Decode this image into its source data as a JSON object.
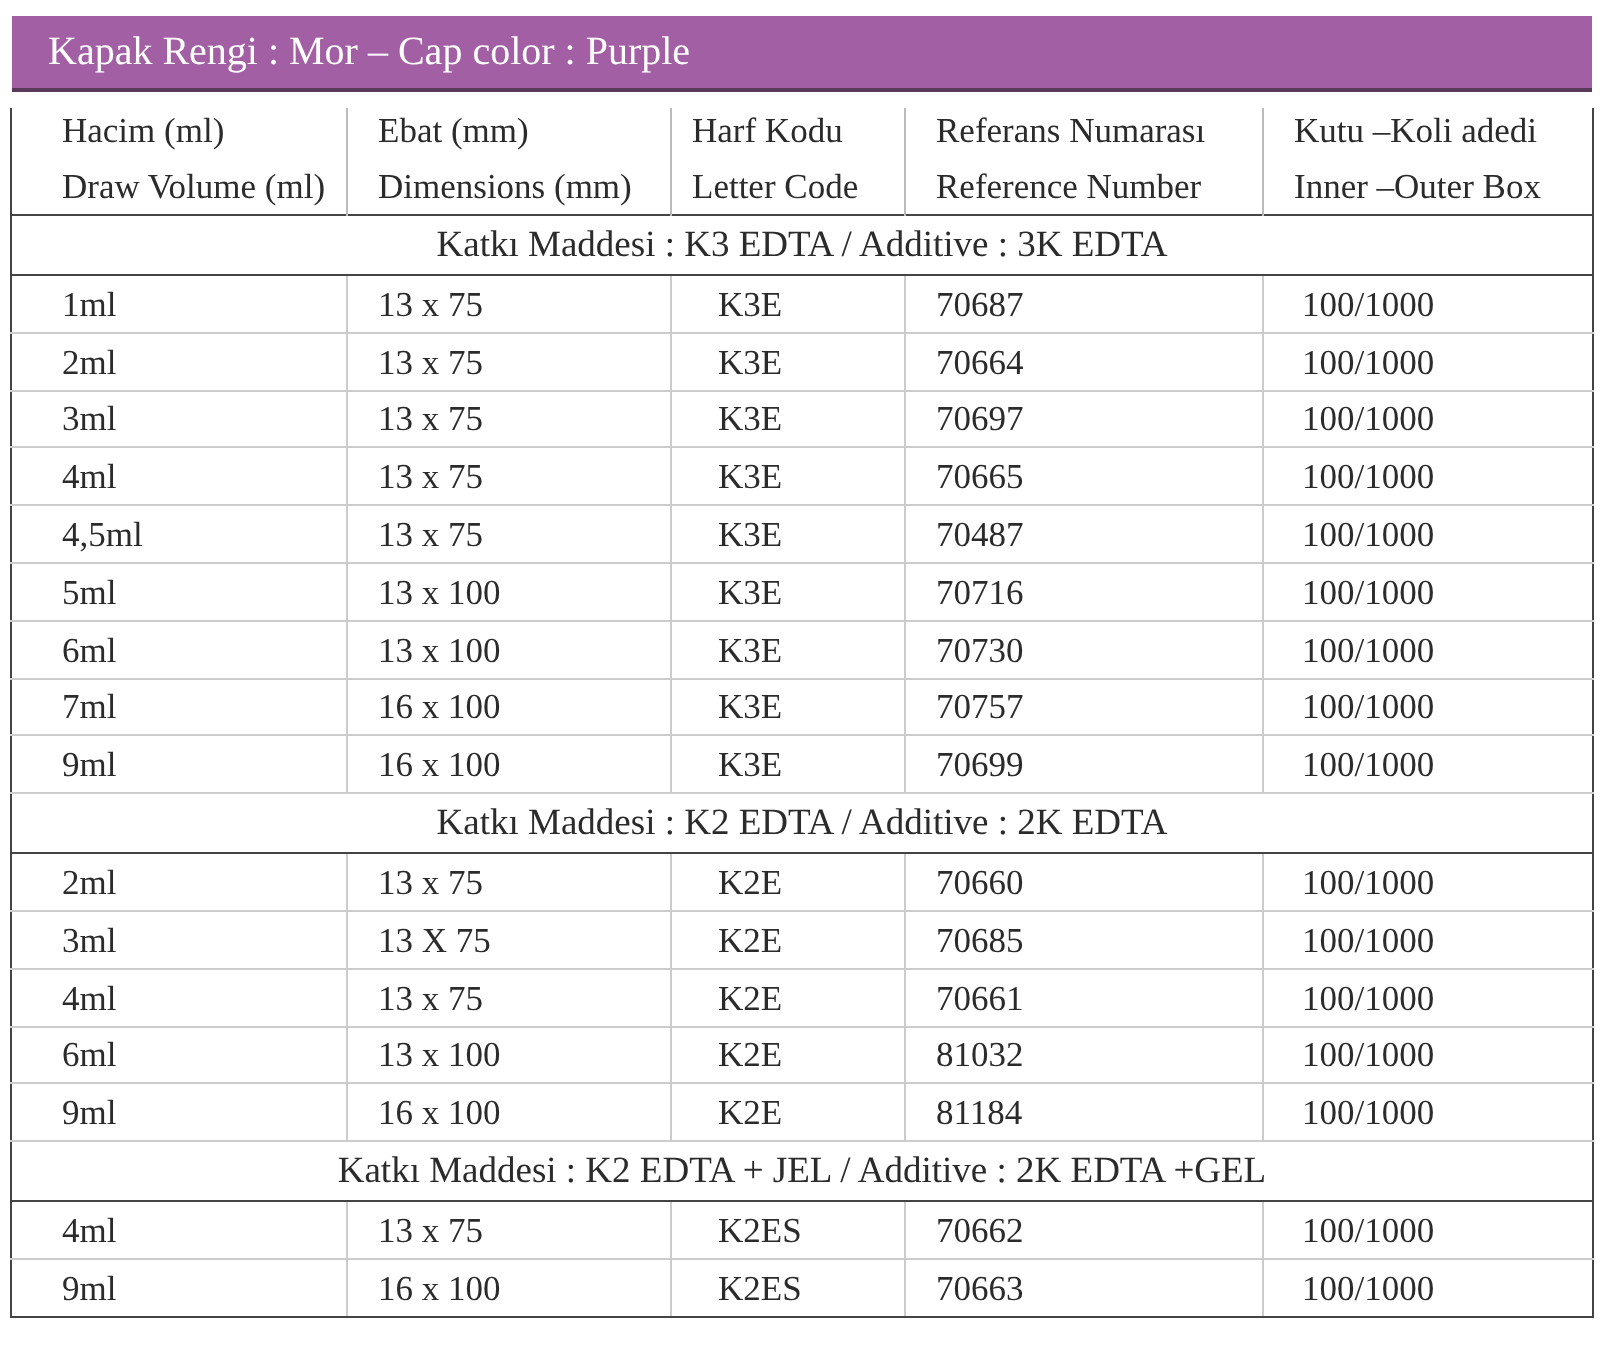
{
  "banner": {
    "title": "Kapak Rengi : Mor –  Cap color : Purple"
  },
  "table": {
    "columns": [
      {
        "line_1": "Hacim (ml)",
        "line_2": "Draw Volume (ml)"
      },
      {
        "line_1": "Ebat  (mm)",
        "line_2": "Dimensions (mm)"
      },
      {
        "line_1": "Harf Kodu",
        "line_2": "Letter Code"
      },
      {
        "line_1": "Referans Numarası",
        "line_2": "Reference Number"
      },
      {
        "line_1": "Kutu –Koli adedi",
        "line_2": "Inner –Outer Box"
      }
    ],
    "groups": [
      {
        "title": "Katkı Maddesi : K3 EDTA / Additive : 3K EDTA",
        "rows": [
          [
            "1ml",
            "13 x 75",
            "K3E",
            "70687",
            "100/1000"
          ],
          [
            "2ml",
            "13 x 75",
            "K3E",
            "70664",
            "100/1000"
          ],
          [
            "3ml",
            "13 x 75",
            "K3E",
            "70697",
            "100/1000"
          ],
          [
            "4ml",
            "13 x 75",
            "K3E",
            "70665",
            "100/1000"
          ],
          [
            "4,5ml",
            "13 x 75",
            "K3E",
            "70487",
            "100/1000"
          ],
          [
            "5ml",
            "13 x 100",
            "K3E",
            "70716",
            "100/1000"
          ],
          [
            "6ml",
            "13 x 100",
            "K3E",
            "70730",
            "100/1000"
          ],
          [
            "7ml",
            "16 x 100",
            "K3E",
            "70757",
            "100/1000"
          ],
          [
            "9ml",
            "16 x 100",
            "K3E",
            "70699",
            "100/1000"
          ]
        ]
      },
      {
        "title": "Katkı Maddesi : K2 EDTA / Additive : 2K EDTA",
        "rows": [
          [
            "2ml",
            "13 x 75",
            "K2E",
            "70660",
            "100/1000"
          ],
          [
            "3ml",
            "13 X 75",
            "K2E",
            "70685",
            "100/1000"
          ],
          [
            "4ml",
            "13 x 75",
            "K2E",
            "70661",
            "100/1000"
          ],
          [
            "6ml",
            "13 x 100",
            "K2E",
            "81032",
            "100/1000"
          ],
          [
            "9ml",
            "16 x 100",
            "K2E",
            "81184",
            "100/1000"
          ]
        ]
      },
      {
        "title": "Katkı Maddesi : K2 EDTA + JEL / Additive : 2K EDTA +GEL",
        "rows": [
          [
            "4ml",
            "13 x 75",
            "K2ES",
            "70662",
            "100/1000"
          ],
          [
            "9ml",
            "16 x 100",
            "K2ES",
            "70663",
            "100/1000"
          ]
        ]
      }
    ]
  }
}
